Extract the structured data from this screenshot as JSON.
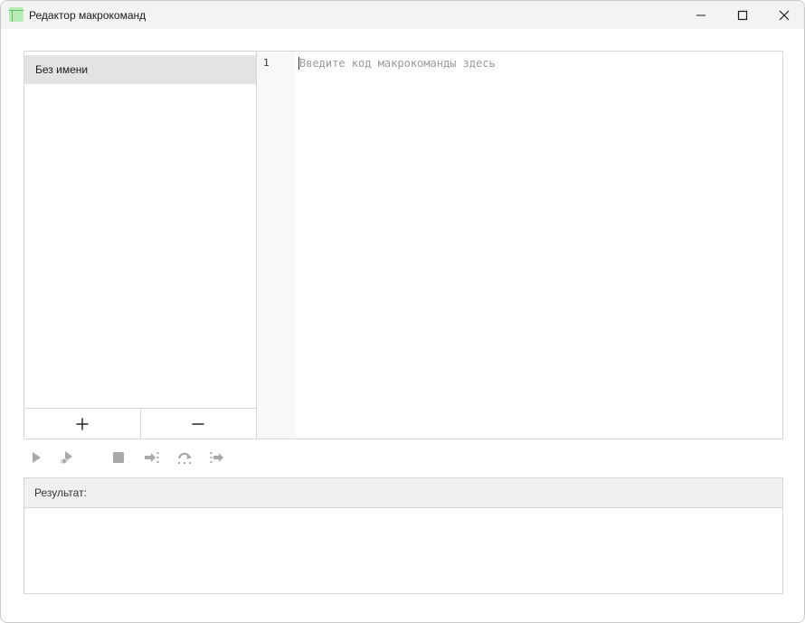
{
  "window": {
    "title": "Редактор макрокоманд",
    "icon": "table-app-icon",
    "controls": [
      "minimize-icon",
      "maximize-icon",
      "close-icon"
    ]
  },
  "macro_list": {
    "items": [
      {
        "label": "Без имени",
        "selected": true
      }
    ],
    "add_button_icon": "plus-icon",
    "remove_button_icon": "minus-icon"
  },
  "editor": {
    "line_numbers": [
      "1"
    ],
    "placeholder": "Введите код макрокоманды здесь",
    "value": ""
  },
  "toolbar": {
    "buttons": [
      "run-icon",
      "debug-icon",
      "stop-icon",
      "step-into-icon",
      "step-over-icon",
      "step-out-icon"
    ],
    "enabled": false
  },
  "result": {
    "label": "Результат:",
    "output": ""
  },
  "colors": {
    "selection_bg": "#e3e3e3",
    "border": "#d6d6d6",
    "disabled_icon": "#a9a9a9",
    "titlebar_bg": "#f3f3f3",
    "app_icon_green": "#b9ecb4"
  }
}
